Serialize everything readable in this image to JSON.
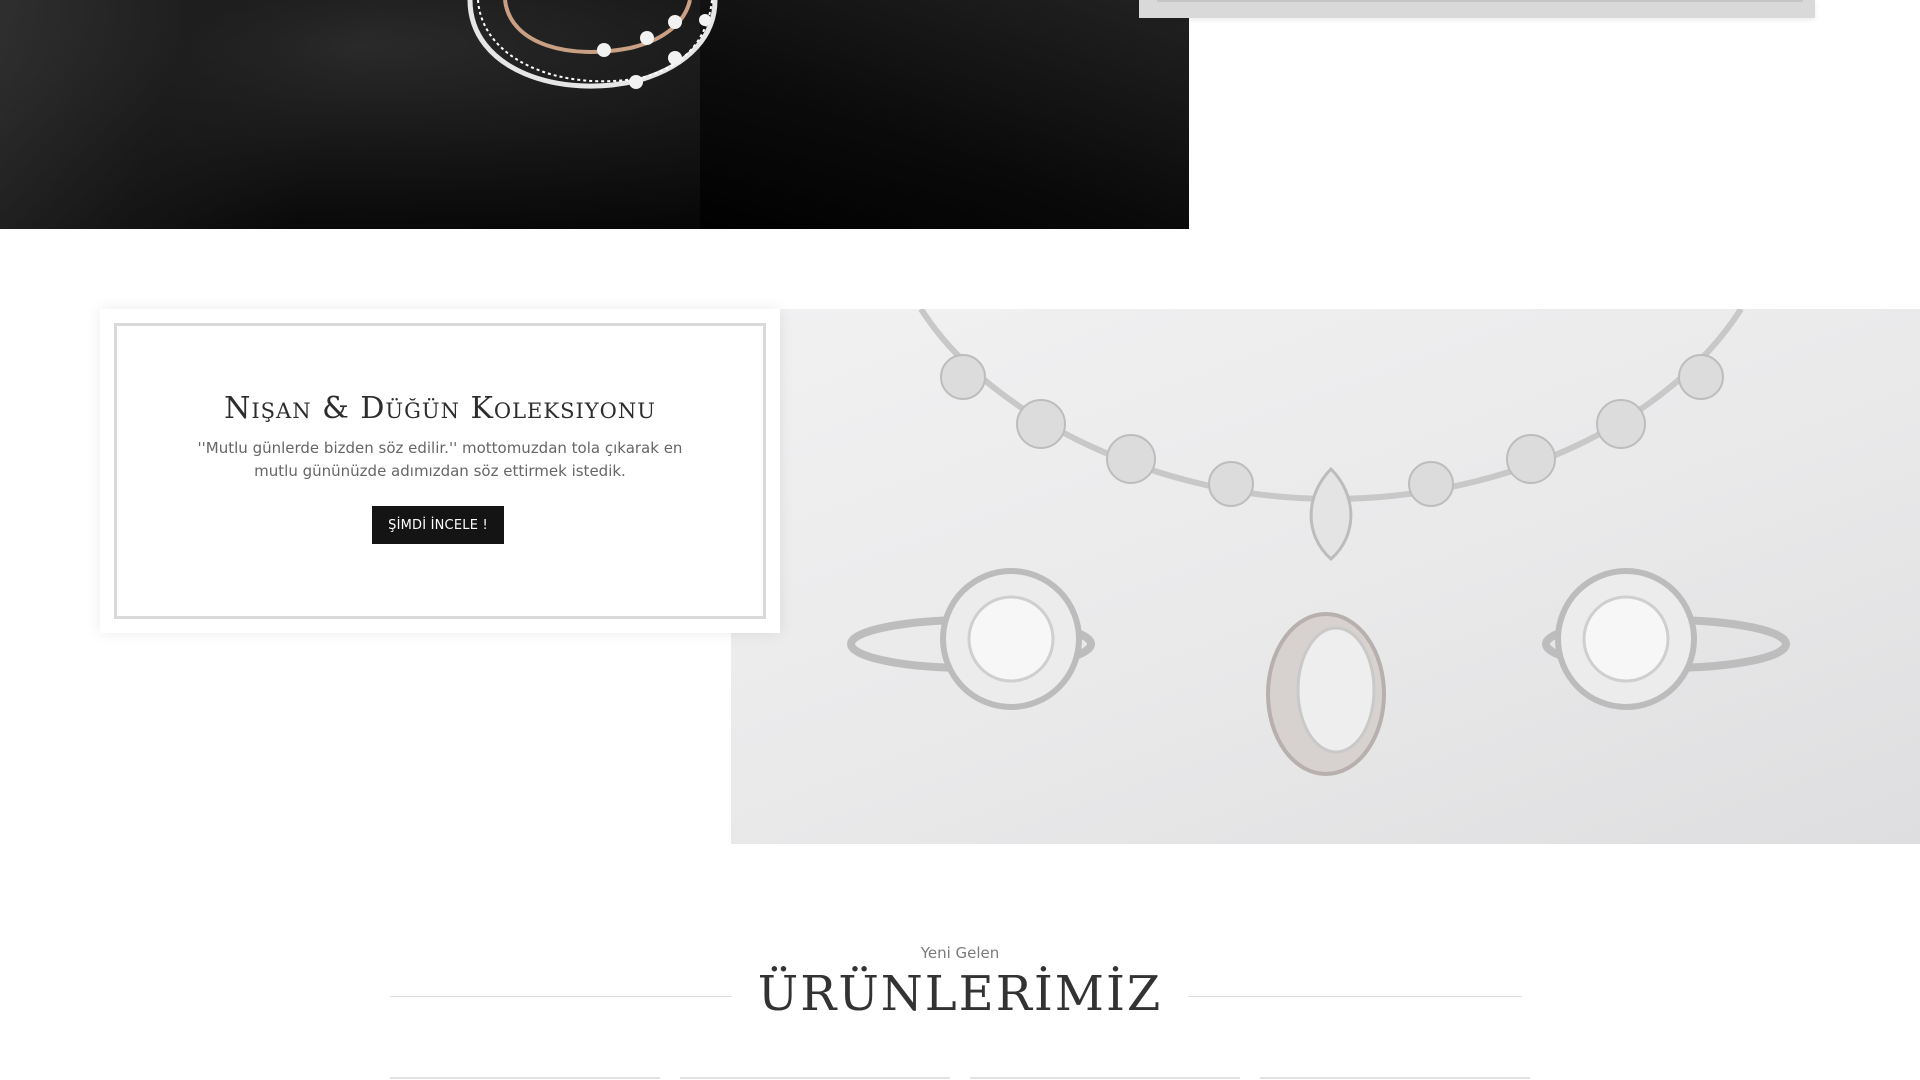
{
  "collection": {
    "title": "Nişan & Düğün Koleksiyonu",
    "description": "''Mutlu günlerde bizden söz edilir.'' mottomuzdan tola çıkarak en mutlu gününüzde adımızdan söz ettirmek istedik.",
    "cta_label": "ŞİMDİ İNCELE !"
  },
  "new_arrivals": {
    "kicker": "Yeni Gelen",
    "title": "ÜRÜNLERİMİZ"
  },
  "colors": {
    "button_bg": "#141414",
    "rule": "#dedede",
    "jewel_bg": "#eaeaeb"
  },
  "images": [
    {
      "name": "necklace-banner-image",
      "description_icon": "necklace-icon"
    },
    {
      "name": "bridal-jewelry-image",
      "description_icon": "ring-icon"
    }
  ]
}
